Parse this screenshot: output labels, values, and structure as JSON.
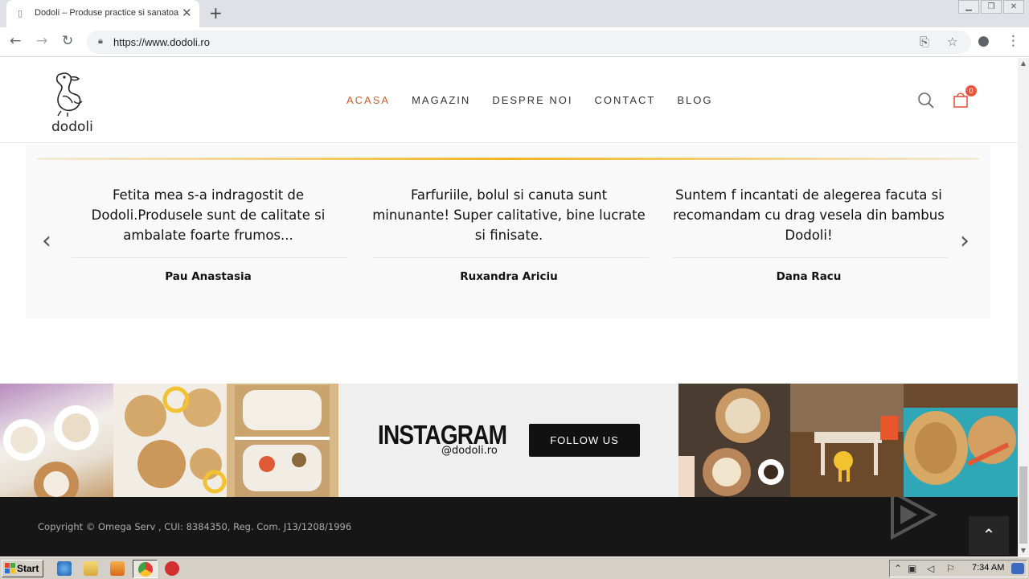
{
  "browser": {
    "tab_title": "Dodoli – Produse practice si sanatoa",
    "url": "https://www.dodoli.ro",
    "new_tab": "+",
    "close_tab": "✕"
  },
  "site": {
    "logo_text": "dodoli",
    "menu": [
      {
        "label": "ACASA",
        "active": true
      },
      {
        "label": "MAGAZIN",
        "active": false
      },
      {
        "label": "DESPRE NOI",
        "active": false
      },
      {
        "label": "CONTACT",
        "active": false
      },
      {
        "label": "BLOG",
        "active": false
      }
    ],
    "cart_count": "0",
    "accent_color": "#c8612f",
    "badge_color": "#e8573c"
  },
  "testimonials": [
    {
      "text": "Fetita mea s-a indragostit de Dodoli.Produsele sunt de calitate si ambalate foarte frumos...",
      "author": "Pau Anastasia"
    },
    {
      "text": "Farfuriile, bolul si canuta sunt minunante! Super calitative, bine lucrate si finisate.",
      "author": "Ruxandra Ariciu"
    },
    {
      "text": "Suntem f incantati de alegerea facuta si recomandam cu drag vesela din bambus Dodoli!",
      "author": "Dana Racu"
    }
  ],
  "instagram": {
    "title": "INSTAGRAM",
    "handle": "@dodoli.ro",
    "follow_label": "FOLLOW US"
  },
  "footer": {
    "copyright": "Copyright © Omega Serv , CUI: 8384350, Reg. Com. J13/1208/1996",
    "watermark": "ANY RUN",
    "to_top": "^"
  },
  "taskbar": {
    "start_label": "Start",
    "clock": "7:34 AM"
  }
}
